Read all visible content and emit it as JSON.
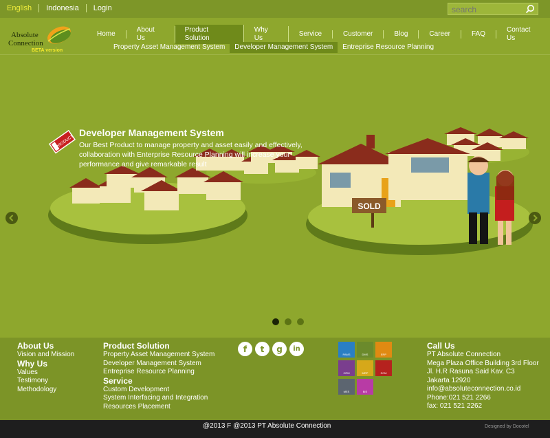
{
  "topbar": {
    "languages": [
      "English",
      "Indonesia",
      "Login"
    ],
    "search_placeholder": "search"
  },
  "logo": {
    "line1": "Absolute",
    "line2": "Connection",
    "beta": "BETA version"
  },
  "nav": {
    "items": [
      "Home",
      "About Us",
      "Product Solution",
      "Why Us",
      "Service",
      "Customer",
      "Blog",
      "Career",
      "FAQ",
      "Contact Us"
    ],
    "active": "Product Solution",
    "sub": [
      "Property Asset Management System",
      "Developer Management System",
      "Entreprise Resource Planning"
    ],
    "sub_active": "Developer Management System"
  },
  "slide": {
    "tag": "PRODUCT",
    "title": "Developer Management System",
    "desc": "Our Best Product to manage property and asset easily and effectively, collaboration with Enterprise Resource Planning will increase your performance and give remarkable result",
    "sign": "SOLD",
    "dots": 3,
    "active_dot": 1
  },
  "footer": {
    "about": {
      "h1": "About Us",
      "l1": "Vision and Mission",
      "h2": "Why Us",
      "items": [
        "Values",
        "Testimony",
        "Methodology"
      ]
    },
    "product": {
      "h1": "Product Solution",
      "items": [
        "Property Asset Management System",
        "Developer Management System",
        "Entreprise Resource Planning"
      ],
      "h2": "Service",
      "items2": [
        "Custom Development",
        "System Interfacing and Integration",
        "Resources Placement"
      ]
    },
    "social": [
      "f",
      "t",
      "g",
      "in"
    ],
    "apps": [
      {
        "label": "PAMS",
        "color": "#2a7fc4"
      },
      {
        "label": "DMS",
        "color": "#6b8a2c"
      },
      {
        "label": "ERP",
        "color": "#e08a12"
      },
      {
        "label": "CRM",
        "color": "#7a3e8e"
      },
      {
        "label": "MRP",
        "color": "#d6a81a"
      },
      {
        "label": "SCM",
        "color": "#b5221e"
      },
      {
        "label": "MES",
        "color": "#5c6570"
      },
      {
        "label": "BIS",
        "color": "#b83ba5"
      }
    ],
    "call": {
      "h": "Call Us",
      "lines": [
        "PT Absolute Connection",
        "Mega Plaza Office Building 3rd Floor",
        "Jl. H.R Rasuna Said Kav. C3",
        "Jakarta 12920",
        "info@absoluteconnection.co.id",
        "Phone:021 521 2266",
        "fax: 021 521 2262"
      ]
    },
    "copyright": "@2013 F @2013 PT Absolute Connection",
    "designed": "Designed by Docotel"
  }
}
